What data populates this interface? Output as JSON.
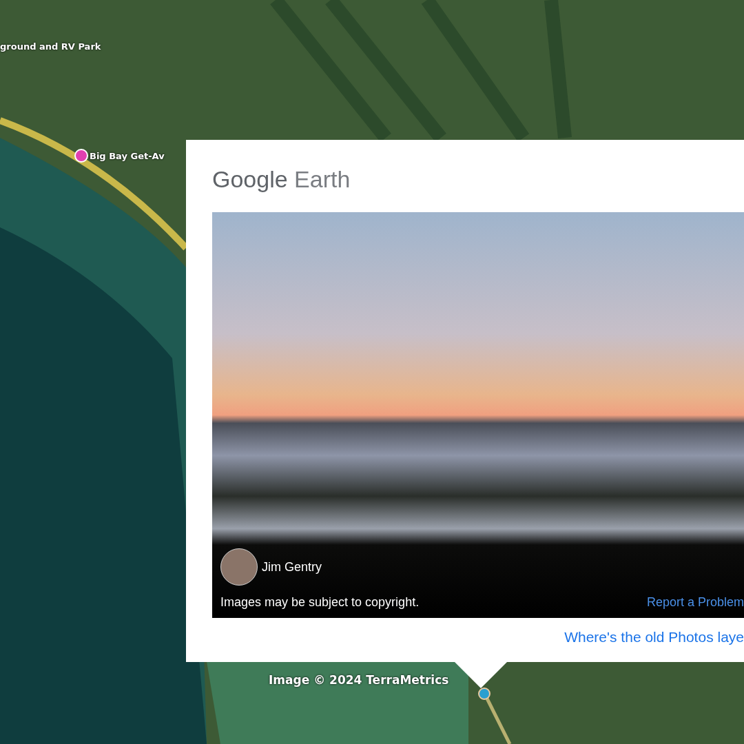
{
  "map": {
    "labels": [
      {
        "text": "ground and RV Park",
        "pin": false
      },
      {
        "text": "Big Bay Get-Av",
        "pin": true
      }
    ],
    "attribution": "Image © 2024 TerraMetrics"
  },
  "popup": {
    "brand": {
      "primary": "Google",
      "secondary": "Earth"
    },
    "photo": {
      "author": "Jim Gentry",
      "notice": "Images may be subject to copyright.",
      "report_link": "Report a Problem"
    },
    "footer_link": "Where's the old Photos laye"
  }
}
